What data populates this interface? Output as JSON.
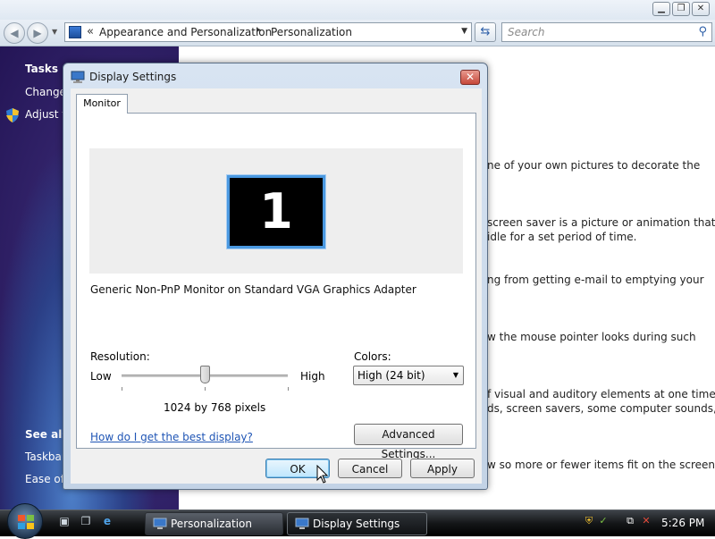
{
  "explorer": {
    "address": {
      "chevron": "«",
      "crumb1": "Appearance and Personalization",
      "separator": "▸",
      "crumb2": "Personalization"
    },
    "search_placeholder": "Search",
    "sidebar": {
      "tasks_heading": "Tasks",
      "task1": "Change",
      "task2": "Adjust f",
      "see_also_heading": "See also",
      "see1": "Taskbar",
      "see2": "Ease of"
    },
    "content_lines": [
      "ne of your own pictures to decorate the",
      "screen saver is a picture or animation that",
      " idle for a set period of time.",
      "ng from getting e-mail to emptying your",
      "w the mouse pointer looks during such",
      "f visual and auditory elements at one time",
      "ds, screen savers, some computer sounds, and",
      "w so more or fewer items fit on the screen."
    ]
  },
  "dialog": {
    "title": "Display Settings",
    "tab": "Monitor",
    "monitor_number": "1",
    "monitor_description": "Generic Non-PnP Monitor on Standard VGA Graphics Adapter",
    "resolution_label": "Resolution:",
    "low_label": "Low",
    "high_label": "High",
    "resolution_value": "1024 by 768 pixels",
    "resolution_slider_fraction": 0.5,
    "colors_label": "Colors:",
    "colors_value": "High (24 bit)",
    "help_link": "How do I get the best display?",
    "advanced_button": "Advanced Settings...",
    "ok_button": "OK",
    "cancel_button": "Cancel",
    "apply_button": "Apply"
  },
  "taskbar": {
    "items": [
      "Personalization",
      "Display Settings"
    ],
    "active_item": "Display Settings",
    "clock": "5:26 PM"
  },
  "colors": {
    "sidebar_purple": "#35266e",
    "accent_blue": "#4a98e0",
    "link_blue": "#1f55b5"
  }
}
